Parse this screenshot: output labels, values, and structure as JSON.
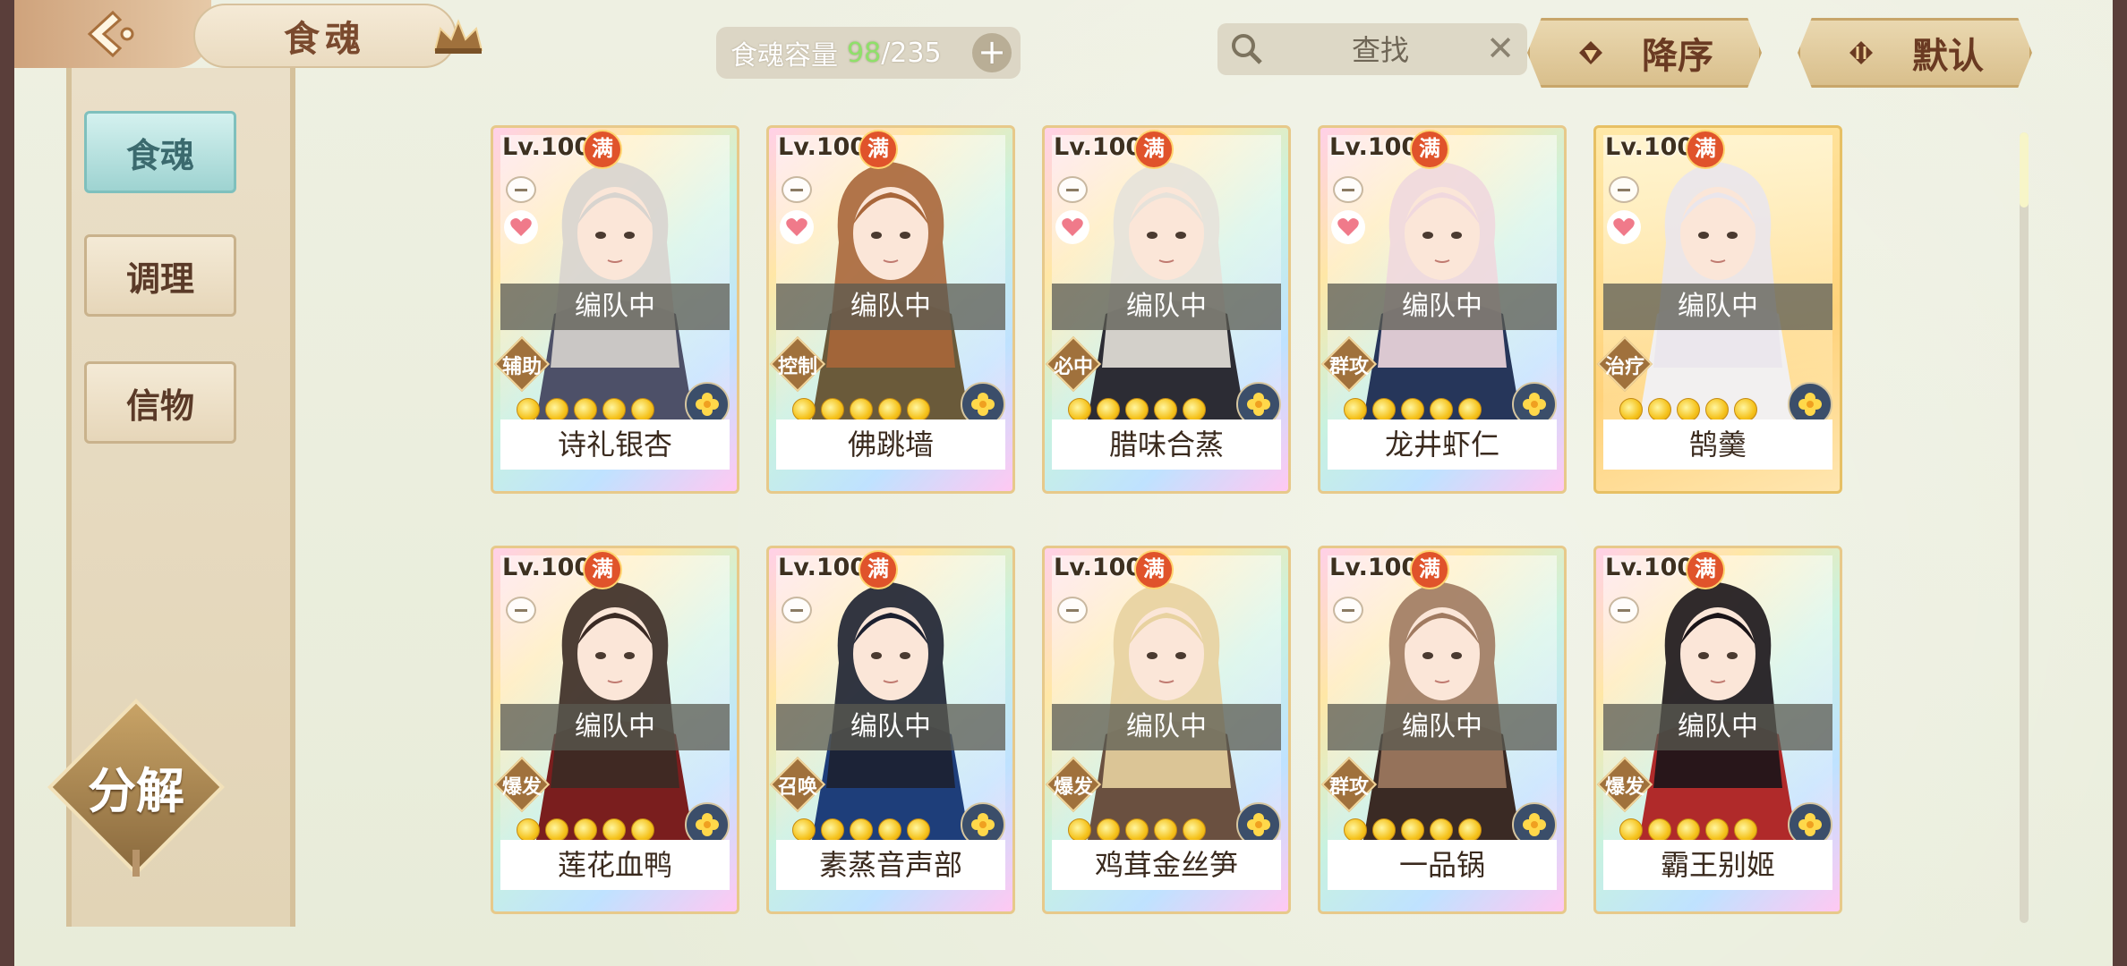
{
  "header": {
    "title": "食魂",
    "capacity_label": "食魂容量",
    "capacity_current": "98",
    "capacity_max": "/235",
    "search_placeholder": "查找",
    "sort_label": "降序",
    "filter_label": "默认"
  },
  "sidebar": {
    "items": [
      {
        "label": "食魂",
        "active": true
      },
      {
        "label": "调理",
        "active": false
      },
      {
        "label": "信物",
        "active": false
      }
    ],
    "decompose_label": "分解"
  },
  "cards": [
    {
      "level": "Lv.100",
      "full": "满",
      "name": "诗礼银杏",
      "role": "辅助",
      "status": "编队中",
      "hair": "#d8d4cf",
      "coat": "#4d5068",
      "gold": false
    },
    {
      "level": "Lv.100",
      "full": "满",
      "name": "佛跳墙",
      "role": "控制",
      "status": "编队中",
      "hair": "#a8663a",
      "coat": "#6a5a3a",
      "gold": false
    },
    {
      "level": "Lv.100",
      "full": "满",
      "name": "腊味合蒸",
      "role": "必中",
      "status": "编队中",
      "hair": "#e6e2da",
      "coat": "#2c2c34",
      "gold": false
    },
    {
      "level": "Lv.100",
      "full": "满",
      "name": "龙井虾仁",
      "role": "群攻",
      "status": "编队中",
      "hair": "#f0d8de",
      "coat": "#26365a",
      "gold": false
    },
    {
      "level": "Lv.100",
      "full": "满",
      "name": "鹄羹",
      "role": "治疗",
      "status": "编队中",
      "hair": "#eae6ec",
      "coat": "#f2f0f0",
      "gold": true
    },
    {
      "level": "Lv.100",
      "full": "满",
      "name": "莲花血鸭",
      "role": "爆发",
      "status": "编队中",
      "hair": "#3a2a24",
      "coat": "#7a1e1e",
      "gold": false
    },
    {
      "level": "Lv.100",
      "full": "满",
      "name": "素蒸音声部",
      "role": "召唤",
      "status": "编队中",
      "hair": "#1c2030",
      "coat": "#1e3e7a",
      "gold": false
    },
    {
      "level": "Lv.100",
      "full": "满",
      "name": "鸡茸金丝笋",
      "role": "爆发",
      "status": "编队中",
      "hair": "#e8d2a0",
      "coat": "#6a5040",
      "gold": false
    },
    {
      "level": "Lv.100",
      "full": "满",
      "name": "一品锅",
      "role": "群攻",
      "status": "编队中",
      "hair": "#a07a60",
      "coat": "#3a2a24",
      "gold": false
    },
    {
      "level": "Lv.100",
      "full": "满",
      "name": "霸王别姬",
      "role": "爆发",
      "status": "编队中",
      "hair": "#1a1418",
      "coat": "#b02a2a",
      "gold": false
    }
  ]
}
